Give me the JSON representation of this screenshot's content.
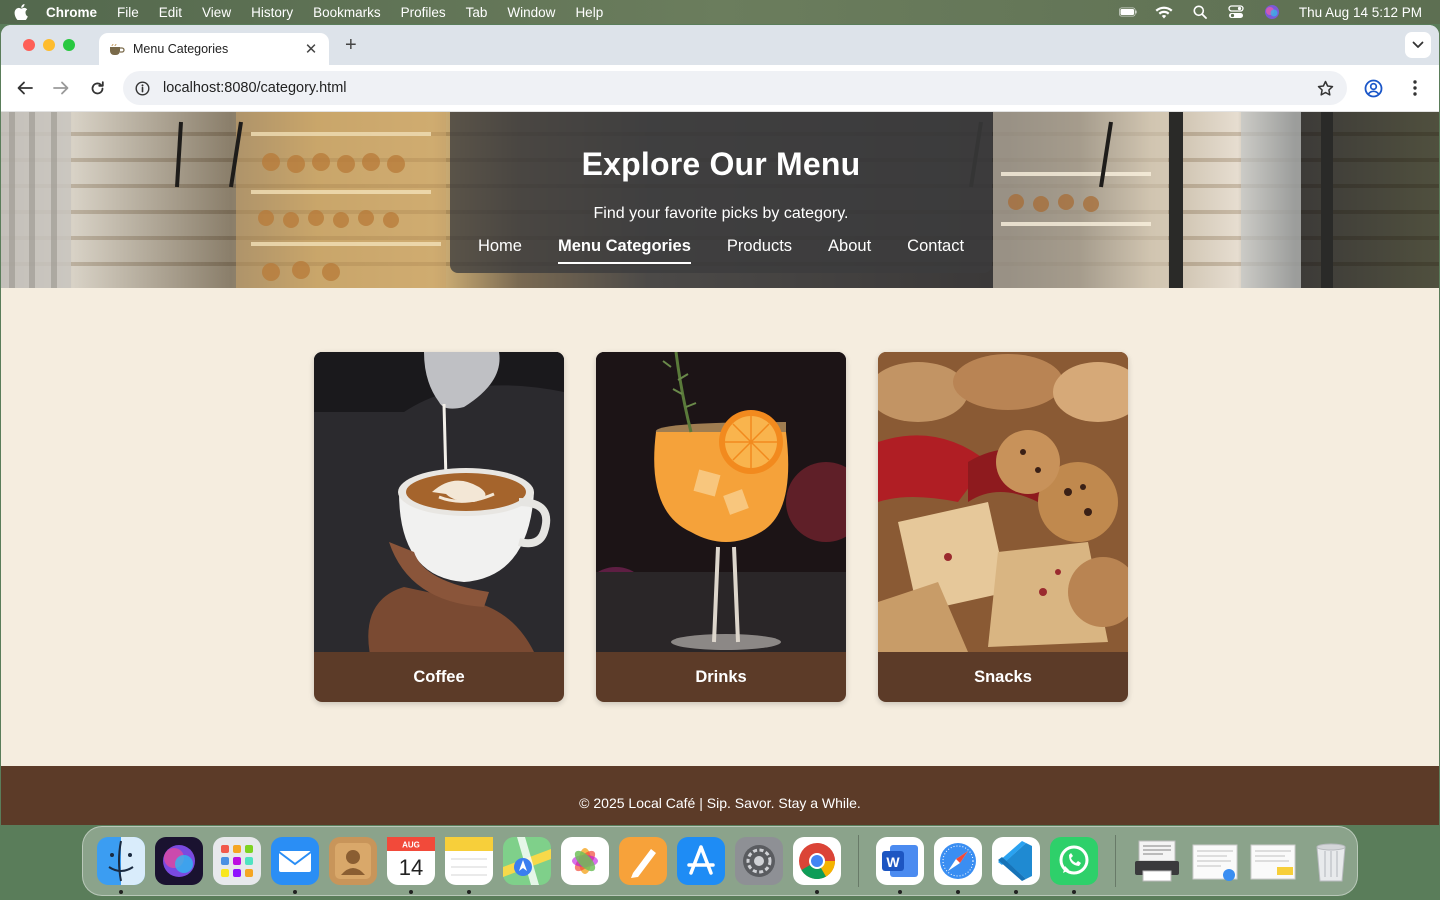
{
  "menubar": {
    "app": "Chrome",
    "items": [
      "File",
      "Edit",
      "View",
      "History",
      "Bookmarks",
      "Profiles",
      "Tab",
      "Window",
      "Help"
    ],
    "datetime": "Thu Aug 14  5:12 PM"
  },
  "browser": {
    "tab_title": "Menu Categories",
    "url": "localhost:8080/category.html"
  },
  "hero": {
    "title": "Explore Our Menu",
    "subtitle": "Find your favorite picks by category.",
    "nav": [
      {
        "label": "Home"
      },
      {
        "label": "Menu Categories"
      },
      {
        "label": "Products"
      },
      {
        "label": "About"
      },
      {
        "label": "Contact"
      }
    ]
  },
  "categories": [
    {
      "label": "Coffee"
    },
    {
      "label": "Drinks"
    },
    {
      "label": "Snacks"
    }
  ],
  "footer": {
    "text": "© 2025 Local Café | Sip. Savor. Stay a While."
  },
  "dock": {
    "calendar_month": "AUG",
    "calendar_day": "14"
  },
  "colors": {
    "page_bg": "#f5eddf",
    "accent_brown": "#5c3b28"
  }
}
